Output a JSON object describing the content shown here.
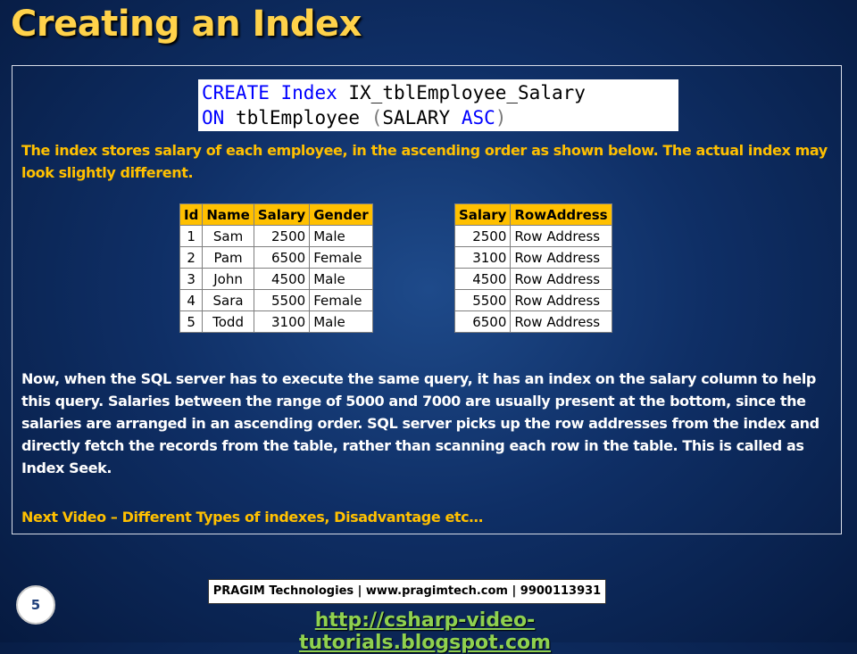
{
  "slide": {
    "title": "Creating an Index",
    "page_number": "5"
  },
  "code": {
    "line1": {
      "kw1": "CREATE",
      "kw2": "Index",
      "name": "IX_tblEmployee_Salary"
    },
    "line2": {
      "kw1": "ON",
      "table": "tblEmployee",
      "open": "(",
      "column": "SALARY",
      "order": "ASC",
      "close": ")"
    }
  },
  "intro_text": "The index stores salary of each employee, in the ascending order as shown below. The actual index may look slightly different.",
  "employee_table": {
    "headers": [
      "Id",
      "Name",
      "Salary",
      "Gender"
    ],
    "rows": [
      [
        "1",
        "Sam",
        "2500",
        "Male"
      ],
      [
        "2",
        "Pam",
        "6500",
        "Female"
      ],
      [
        "3",
        "John",
        "4500",
        "Male"
      ],
      [
        "4",
        "Sara",
        "5500",
        "Female"
      ],
      [
        "5",
        "Todd",
        "3100",
        "Male"
      ]
    ]
  },
  "index_table": {
    "headers": [
      "Salary",
      "RowAddress"
    ],
    "rows": [
      [
        "2500",
        "Row Address"
      ],
      [
        "3100",
        "Row Address"
      ],
      [
        "4500",
        "Row Address"
      ],
      [
        "5500",
        "Row Address"
      ],
      [
        "6500",
        "Row Address"
      ]
    ]
  },
  "body_text": "Now, when the SQL server has to execute the same query, it has an index on the salary column to help this query. Salaries between the range of 5000 and 7000 are usually present at the bottom, since the salaries are arranged in an ascending order. SQL server picks up the row addresses from the index and directly fetch the records from the table, rather than scanning each row in the table. This is called as Index Seek.",
  "next_video_text": "Next Video – Different Types of indexes, Disadvantage etc…",
  "footer": {
    "company": "PRAGIM Technologies | www.pragimtech.com | 9900113931",
    "url": "http://csharp-video-tutorials.blogspot.com"
  },
  "colors": {
    "title": "#ffd24a",
    "accent_text": "#ffc000",
    "header_fill": "#ffc000",
    "keyword": "#0000ff",
    "url": "#8fd14f"
  }
}
